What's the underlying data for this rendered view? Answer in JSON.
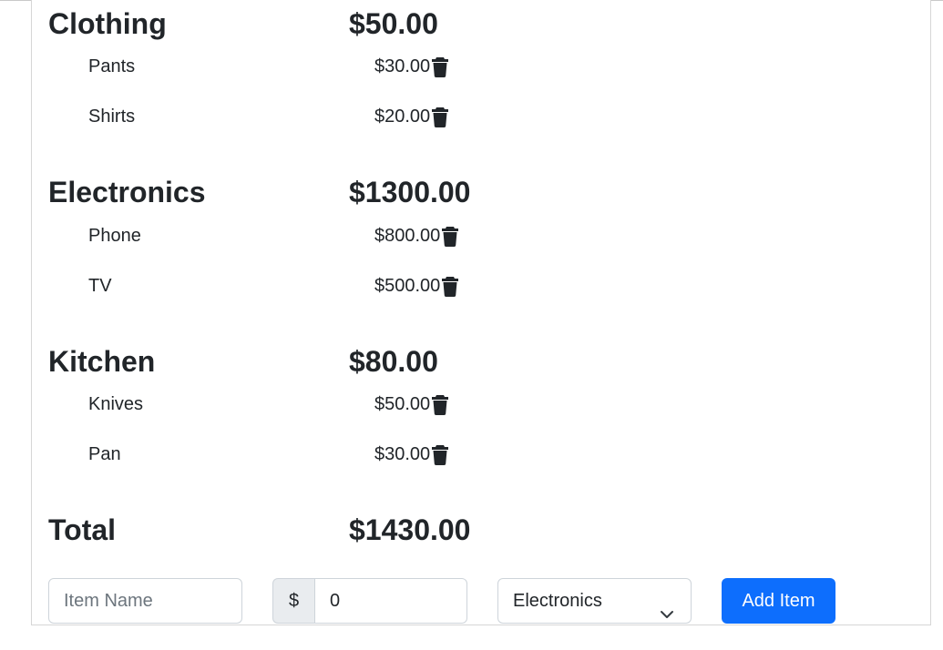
{
  "categories": [
    {
      "name": "Clothing",
      "total": "$50.00",
      "items": [
        {
          "name": "Pants",
          "price": "$30.00"
        },
        {
          "name": "Shirts",
          "price": "$20.00"
        }
      ]
    },
    {
      "name": "Electronics",
      "total": "$1300.00",
      "items": [
        {
          "name": "Phone",
          "price": "$800.00"
        },
        {
          "name": "TV",
          "price": "$500.00"
        }
      ]
    },
    {
      "name": "Kitchen",
      "total": "$80.00",
      "items": [
        {
          "name": "Knives",
          "price": "$50.00"
        },
        {
          "name": "Pan",
          "price": "$30.00"
        }
      ]
    }
  ],
  "grand_total": {
    "label": "Total",
    "value": "$1430.00"
  },
  "form": {
    "item_name_placeholder": "Item Name",
    "currency_symbol": "$",
    "amount_value": "0",
    "category_selected": "Electronics",
    "add_button_label": "Add Item"
  },
  "icons": {
    "delete": "trash-icon",
    "select": "chevron-down-icon"
  },
  "colors": {
    "primary": "#0d6efd",
    "text": "#212529"
  }
}
